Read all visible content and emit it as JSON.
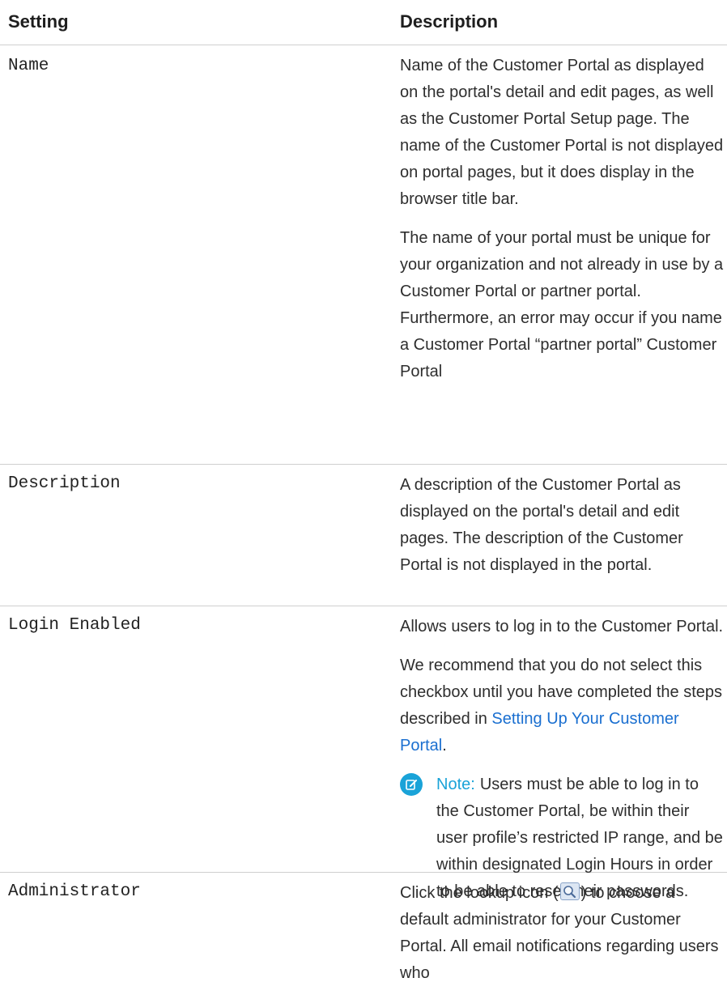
{
  "table": {
    "headers": {
      "setting": "Setting",
      "description": "Description"
    },
    "rows": [
      {
        "setting": "Name",
        "paragraphs": [
          "Name of the Customer Portal as displayed on the portal's detail and edit pages, as well as the Customer Portal Setup page. The name of the Customer Portal is not displayed on portal pages, but it does display in the browser title bar.",
          "The name of your portal must be unique for your organization and not already in use by a Customer Portal or partner portal. Furthermore, an error may occur if you name a Customer Portal “partner portal” Customer Portal"
        ]
      },
      {
        "setting": "Description",
        "paragraphs": [
          "A description of the Customer Portal as displayed on the portal's detail and edit pages. The description of the Customer Portal is not displayed in the portal."
        ]
      },
      {
        "setting": "Login Enabled",
        "paragraphs": [
          "Allows users to log in to the Customer Portal."
        ],
        "p2_before": "We recommend that you do not select this checkbox until you have completed the steps described in ",
        "p2_link": "Setting Up Your Customer Portal",
        "p2_after": ".",
        "note_label": "Note:",
        "note_text": "Users must be able to log in to the Customer Portal, be within their user profile’s restricted IP range, and be within designated Login Hours in order to be able to reset their passwords."
      },
      {
        "setting": "Administrator",
        "p_before": "Click the lookup icon (",
        "p_after": ") to choose a default administrator for your Customer Portal. All email notifications regarding users who"
      }
    ]
  },
  "icons": {
    "note": "edit-note-icon",
    "lookup": "lookup-icon"
  },
  "colors": {
    "link": "#1a6fd0",
    "note_accent": "#1aa3d8",
    "divider": "#cfcfcf"
  }
}
